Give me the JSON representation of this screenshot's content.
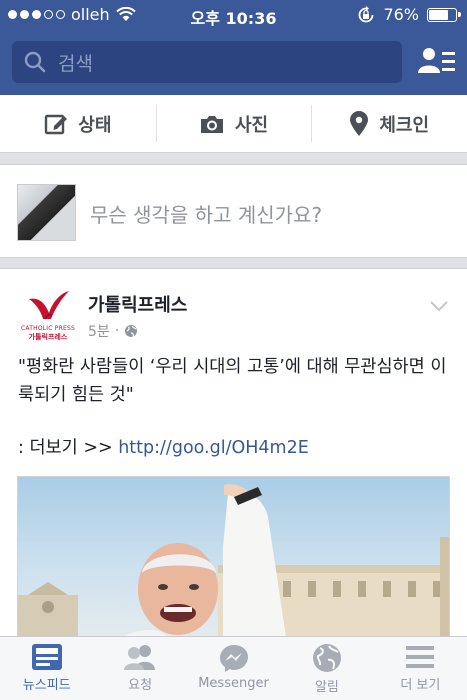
{
  "status_bar": {
    "carrier": "olleh",
    "signal_bars_filled": 3,
    "signal_bars_total": 5,
    "time": "오후 10:36",
    "battery_text": "76%",
    "battery_level": 0.76
  },
  "search": {
    "placeholder": "검색"
  },
  "composer": {
    "status_label": "상태",
    "photo_label": "사진",
    "checkin_label": "체크인"
  },
  "prompt": {
    "text": "무슨 생각을 하고 계신가요?"
  },
  "post": {
    "page_name": "가톨릭프레스",
    "logo_text_en": "CATHOLIC PRESS",
    "logo_text_ko": "가톨릭프레스",
    "time": "5분",
    "separator": "·",
    "body": "\"평화란 사람들이 ‘우리 시대의 고통’에 대해 무관심하면 이룩되기 힘든 것\"",
    "more_prefix": ": 더보기 >> ",
    "link": "http://goo.gl/OH4m2E"
  },
  "tabbar": {
    "tabs": [
      {
        "label": "뉴스피드",
        "icon": "newsfeed-icon",
        "active": true
      },
      {
        "label": "요청",
        "icon": "friend-requests-icon",
        "active": false
      },
      {
        "label": "Messenger",
        "icon": "messenger-icon",
        "active": false
      },
      {
        "label": "알림",
        "icon": "notifications-globe-icon",
        "active": false
      },
      {
        "label": "더 보기",
        "icon": "more-menu-icon",
        "active": false
      }
    ]
  },
  "colors": {
    "brand_blue": "#3b5998",
    "search_bg": "#2c4580",
    "link": "#365899",
    "active_tab": "#4267b2",
    "logo_red": "#c4122f"
  }
}
